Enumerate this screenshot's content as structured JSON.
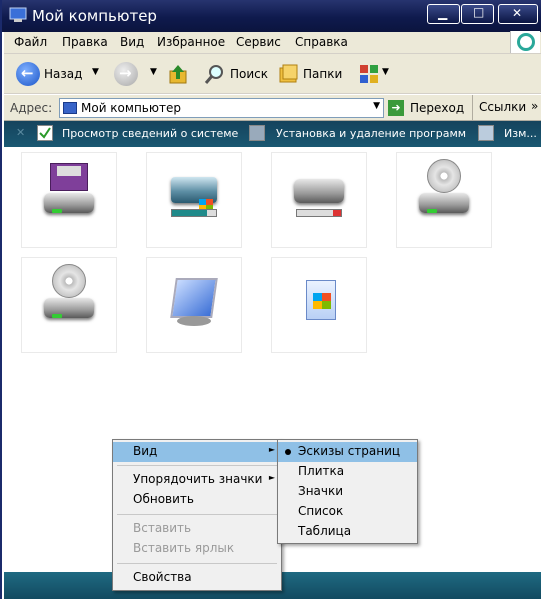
{
  "window": {
    "title": "Мой компьютер",
    "minimize": "▁",
    "maximize": "□",
    "close": "✕"
  },
  "menu": {
    "items": [
      "Файл",
      "Правка",
      "Вид",
      "Избранное",
      "Сервис",
      "Справка"
    ]
  },
  "toolbar": {
    "back": "Назад",
    "search": "Поиск",
    "folders": "Папки"
  },
  "address": {
    "label": "Адрес:",
    "value": "Мой компьютер",
    "go": "Переход",
    "links": "Ссылки",
    "chevron": "»"
  },
  "tasks": [
    "Просмотр сведений о системе",
    "Установка и удаление программ",
    "Изм..."
  ],
  "items": [
    {
      "icon": "floppy-drive-icon"
    },
    {
      "icon": "local-disk-system-icon"
    },
    {
      "icon": "local-disk-icon"
    },
    {
      "icon": "cd-drive-icon"
    },
    {
      "icon": "dvd-drive-icon"
    },
    {
      "icon": "control-panel-icon"
    },
    {
      "icon": "shared-documents-icon"
    }
  ],
  "context_menu": {
    "items": [
      {
        "label": "Вид",
        "submenu": true,
        "highlighted": true,
        "disabled": false
      },
      {
        "label": "Упорядочить значки",
        "submenu": true,
        "highlighted": false,
        "disabled": false
      },
      {
        "label": "Обновить",
        "submenu": false,
        "highlighted": false,
        "disabled": false
      },
      {
        "label": "Вставить",
        "submenu": false,
        "highlighted": false,
        "disabled": true
      },
      {
        "label": "Вставить ярлык",
        "submenu": false,
        "highlighted": false,
        "disabled": true
      },
      {
        "label": "Свойства",
        "submenu": false,
        "highlighted": false,
        "disabled": false
      }
    ]
  },
  "submenu": {
    "items": [
      "Эскизы страниц",
      "Плитка",
      "Значки",
      "Список",
      "Таблица"
    ],
    "selected": "Эскизы страниц"
  },
  "colors": {
    "titlebar": "#0f1a4d",
    "highlight": "#8fc0e6",
    "taskbar": "#15435d"
  }
}
